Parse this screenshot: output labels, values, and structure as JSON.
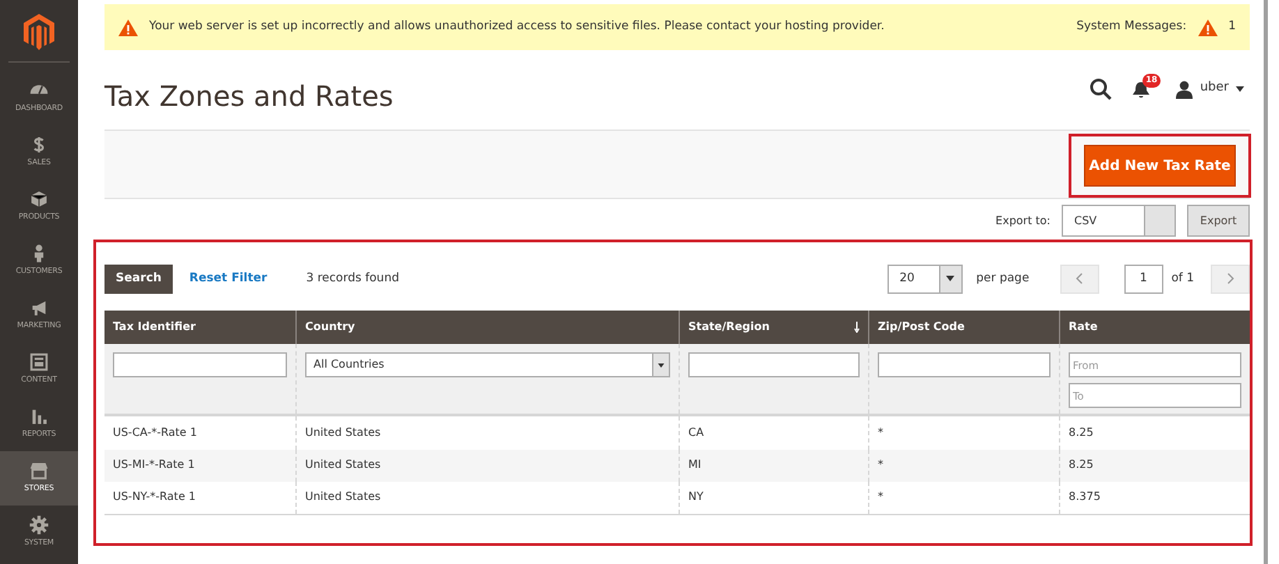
{
  "sidebar": {
    "items": [
      {
        "label": "DASHBOARD",
        "selected": false
      },
      {
        "label": "SALES",
        "selected": false
      },
      {
        "label": "PRODUCTS",
        "selected": false
      },
      {
        "label": "CUSTOMERS",
        "selected": false
      },
      {
        "label": "MARKETING",
        "selected": false
      },
      {
        "label": "CONTENT",
        "selected": false
      },
      {
        "label": "REPORTS",
        "selected": false
      },
      {
        "label": "STORES",
        "selected": true
      },
      {
        "label": "SYSTEM",
        "selected": false
      }
    ]
  },
  "message_bar": {
    "text": "Your web server is set up incorrectly and allows unauthorized access to sensitive files. Please contact your hosting provider.",
    "system_messages_label": "System Messages:",
    "system_messages_count": "1"
  },
  "header": {
    "title": "Tax Zones and Rates",
    "notifications": "18",
    "user": "uber"
  },
  "actions": {
    "add_button": "Add New Tax Rate"
  },
  "export": {
    "label": "Export to:",
    "format": "CSV",
    "button": "Export"
  },
  "toolbar": {
    "search": "Search",
    "reset": "Reset Filter",
    "records": "3 records found",
    "per_page_value": "20",
    "per_page_label": "per page",
    "page": "1",
    "page_of": "of 1"
  },
  "table": {
    "columns": [
      {
        "label": "Tax Identifier",
        "sorted": false,
        "kind": "text"
      },
      {
        "label": "Country",
        "sorted": false,
        "kind": "select",
        "value": "All Countries"
      },
      {
        "label": "State/Region",
        "sorted": true,
        "kind": "text"
      },
      {
        "label": "Zip/Post Code",
        "sorted": false,
        "kind": "text"
      },
      {
        "label": "Rate",
        "sorted": false,
        "kind": "range",
        "fields": [
          {
            "placeholder": "From"
          },
          {
            "placeholder": "To"
          }
        ]
      }
    ],
    "rows": [
      [
        "US-CA-*-Rate 1",
        "United States",
        "CA",
        "*",
        "8.25"
      ],
      [
        "US-MI-*-Rate 1",
        "United States",
        "MI",
        "*",
        "8.25"
      ],
      [
        "US-NY-*-Rate 1",
        "United States",
        "NY",
        "*",
        "8.375"
      ]
    ]
  }
}
